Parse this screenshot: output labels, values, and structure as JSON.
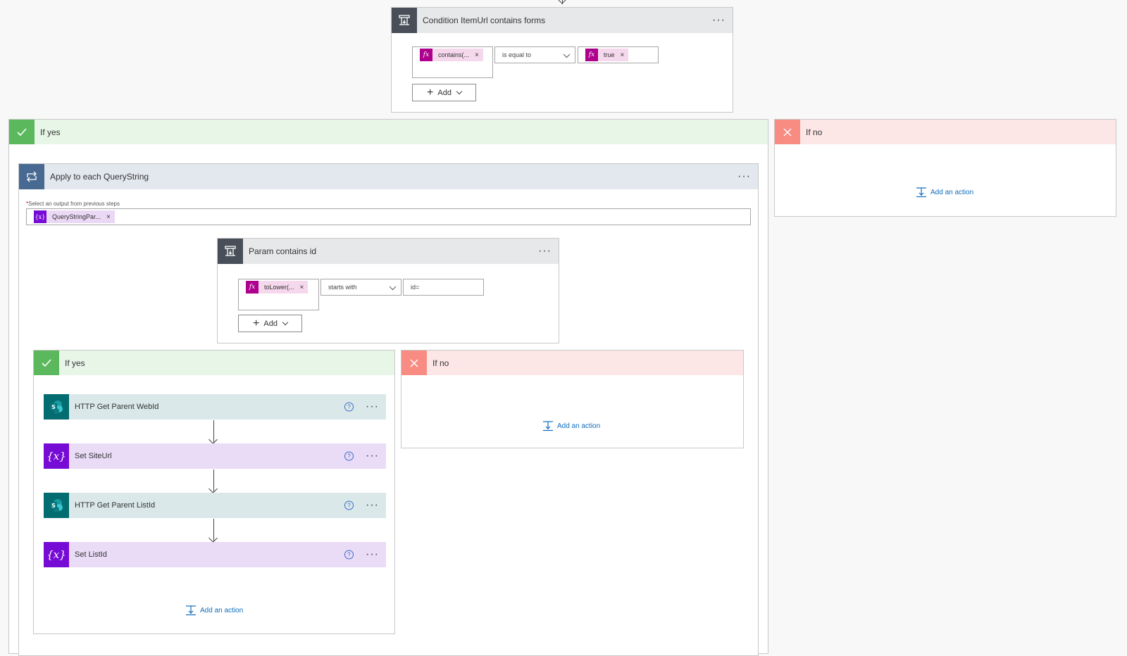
{
  "top_condition": {
    "title": "Condition ItemUrl contains forms",
    "left_token": "contains(...",
    "operator": "is equal to",
    "right_token": "true",
    "add_label": "Add",
    "menu": "···"
  },
  "outer_yes": {
    "label": "If yes"
  },
  "outer_no": {
    "label": "If no",
    "add_action": "Add an action"
  },
  "apply_each": {
    "title": "Apply to each QueryString",
    "field_label": "Select an output from previous steps",
    "field_token": "QueryStringPar...",
    "menu": "···"
  },
  "inner_condition": {
    "title": "Param contains id",
    "left_token": "toLower(...",
    "operator": "starts with",
    "value": "id=",
    "add_label": "Add",
    "menu": "···"
  },
  "inner_yes": {
    "label": "If yes",
    "steps": [
      {
        "title": "HTTP Get Parent WebId",
        "type": "sharepoint"
      },
      {
        "title": "Set SiteUrl",
        "type": "variable"
      },
      {
        "title": "HTTP Get Parent ListId",
        "type": "sharepoint"
      },
      {
        "title": "Set ListId",
        "type": "variable"
      }
    ],
    "add_action": "Add an action"
  },
  "inner_no": {
    "label": "If no",
    "add_action": "Add an action"
  },
  "colors": {
    "condition_icon": "#484f58",
    "loop_icon": "#486991",
    "yes_green": "#5cb85c",
    "yes_bg": "#e8f6e8",
    "no_red": "#f88b82",
    "no_bg": "#fde6e6",
    "sharepoint": "#036c70",
    "sharepoint_bg": "#dae8e9",
    "variable": "#770bd6",
    "variable_bg": "#eadbf7",
    "expression": "#ad008c",
    "link": "#0f6cbd"
  }
}
